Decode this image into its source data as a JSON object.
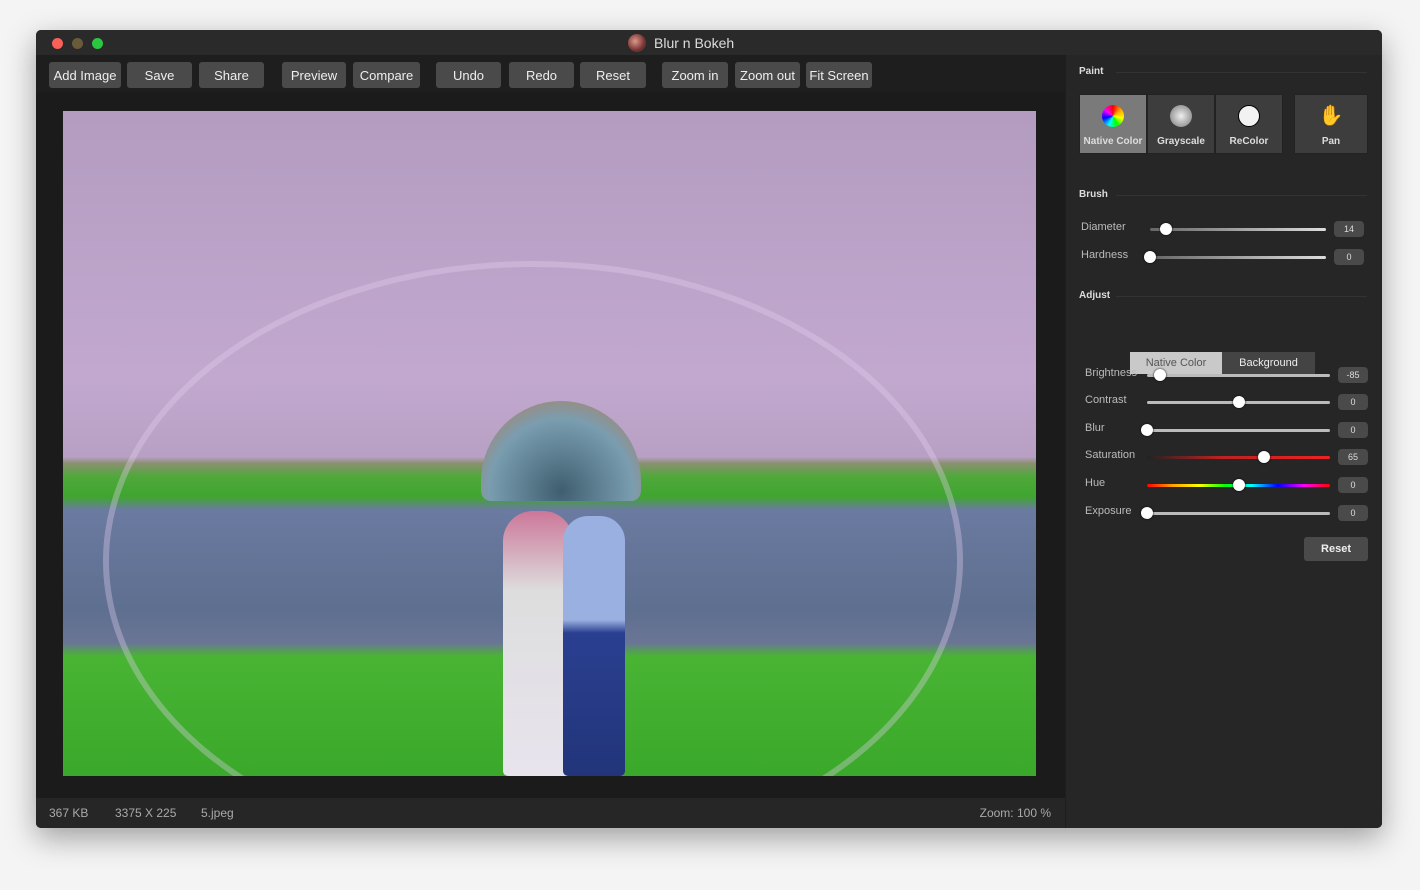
{
  "window": {
    "title": "Blur n Bokeh"
  },
  "toolbar": [
    {
      "label": "Add Image"
    },
    {
      "label": "Save"
    },
    {
      "label": "Share"
    },
    {
      "label": "Preview"
    },
    {
      "label": "Compare"
    },
    {
      "label": "Undo"
    },
    {
      "label": "Redo"
    },
    {
      "label": "Reset"
    },
    {
      "label": "Zoom in"
    },
    {
      "label": "Zoom out"
    },
    {
      "label": "Fit Screen"
    }
  ],
  "status": {
    "size": "367 KB",
    "dimensions": "3375 X 225",
    "filename": "5.jpeg",
    "zoom": "Zoom: 100 %"
  },
  "panel": {
    "paint_title": "Paint",
    "tools": [
      {
        "label": "Native Color",
        "icon": "color-wheel-icon"
      },
      {
        "label": "Grayscale",
        "icon": "grayscale-icon"
      },
      {
        "label": "ReColor",
        "icon": "recolor-icon"
      },
      {
        "label": "Pan",
        "icon": "hand-icon"
      }
    ],
    "brush_title": "Brush",
    "brush": [
      {
        "label": "Diameter",
        "value": "14",
        "position": 0.09
      },
      {
        "label": "Hardness",
        "value": "0",
        "position": 0
      }
    ],
    "adjust_title": "Adjust",
    "adjust_tabs": [
      "Native Color",
      "Background"
    ],
    "adjust": [
      {
        "label": "Brightness",
        "value": "-85",
        "position": 0.07
      },
      {
        "label": "Contrast",
        "value": "0",
        "position": 0.5
      },
      {
        "label": "Blur",
        "value": "0",
        "position": 0
      },
      {
        "label": "Saturation",
        "value": "65",
        "position": 0.64
      },
      {
        "label": "Hue",
        "value": "0",
        "position": 0.5
      },
      {
        "label": "Exposure",
        "value": "0",
        "position": 0
      }
    ],
    "reset_label": "Reset"
  }
}
